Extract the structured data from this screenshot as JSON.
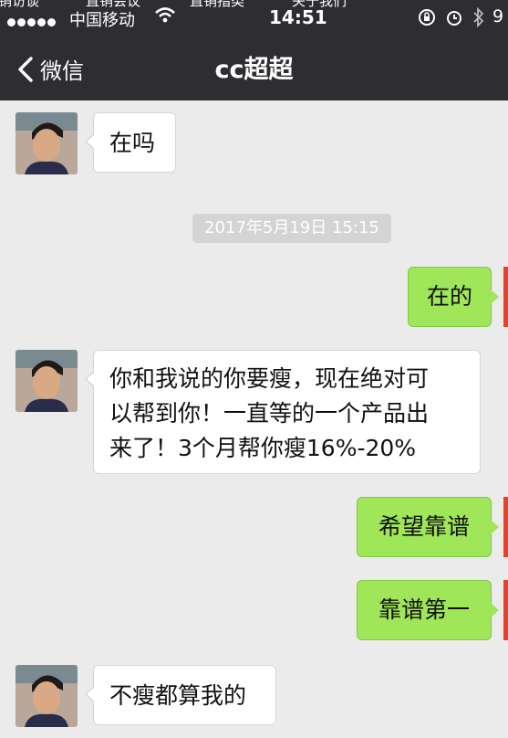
{
  "status_bar": {
    "top_cut_texts": [
      "销访谈",
      "直销会议",
      "直销指类",
      "关于我们"
    ],
    "carrier": "中国移动",
    "time": "14:51",
    "battery": "9"
  },
  "nav": {
    "back_label": "微信",
    "title": "cc超超"
  },
  "messages": [
    {
      "side": "left",
      "text": "在吗"
    },
    {
      "side": "right",
      "text": "在的"
    },
    {
      "side": "left",
      "text": "你和我说的你要瘦，现在绝对可以帮到你！一直等的一个产品出来了！3个月帮你瘦16%-20%"
    },
    {
      "side": "right",
      "text": "希望靠谱"
    },
    {
      "side": "right",
      "text": "靠谱第一"
    },
    {
      "side": "left",
      "text": "不瘦都算我的"
    }
  ],
  "msg_lines": {
    "line1": "你和我说的你要瘦，现在绝对可",
    "line2": "以帮到你！一直等的一个产品出",
    "line3": "来了！3个月帮你瘦16%-20%"
  },
  "timestamp": "2017年5月19日 15:15",
  "colors": {
    "nav_bg": "#2e2e32",
    "chat_bg": "#ebebeb",
    "my_bubble": "#9fe658",
    "their_bubble": "#ffffff"
  },
  "icons": [
    "chevron-left-icon",
    "wifi-icon",
    "orientation-lock-icon",
    "alarm-icon",
    "bluetooth-icon",
    "avatar-image"
  ]
}
